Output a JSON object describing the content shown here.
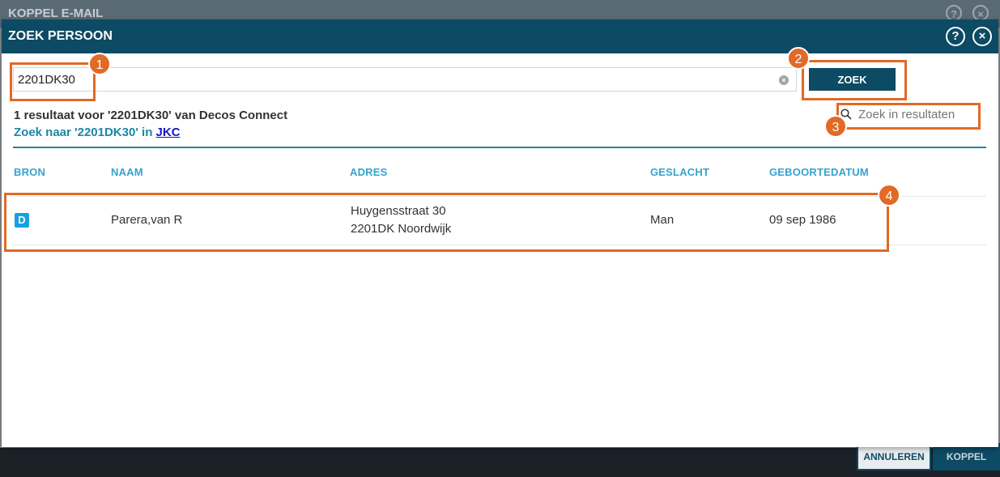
{
  "background_window": {
    "title": "KOPPEL E-MAIL",
    "cancel_label": "ANNULEREN",
    "ok_label": "KOPPEL"
  },
  "dialog": {
    "title": "ZOEK PERSOON",
    "help_icon": "help-icon",
    "close_icon": "close-icon"
  },
  "search": {
    "value": "2201DK30",
    "button_label": "ZOEK"
  },
  "results": {
    "summary": "1 resultaat voor '2201DK30' van Decos Connect",
    "alt_prefix": "Zoek naar '2201DK30' in ",
    "alt_link": "JKC",
    "filter_placeholder": "Zoek in resultaten"
  },
  "table": {
    "headers": [
      "BRON",
      "NAAM",
      "ADRES",
      "GESLACHT",
      "GEBOORTEDATUM"
    ],
    "rows": [
      {
        "bron": "D",
        "naam": "Parera,van R",
        "adres_line1": "Huygensstraat 30",
        "adres_line2": "2201DK Noordwijk",
        "geslacht": "Man",
        "geboortedatum": "09 sep 1986"
      }
    ]
  },
  "annotations": [
    "1",
    "2",
    "3",
    "4"
  ],
  "colors": {
    "header_bg": "#0d4a63",
    "accent": "#1c87a5",
    "column_header": "#35a3cf",
    "annotation": "#e06a26",
    "badge": "#16a1e0"
  }
}
